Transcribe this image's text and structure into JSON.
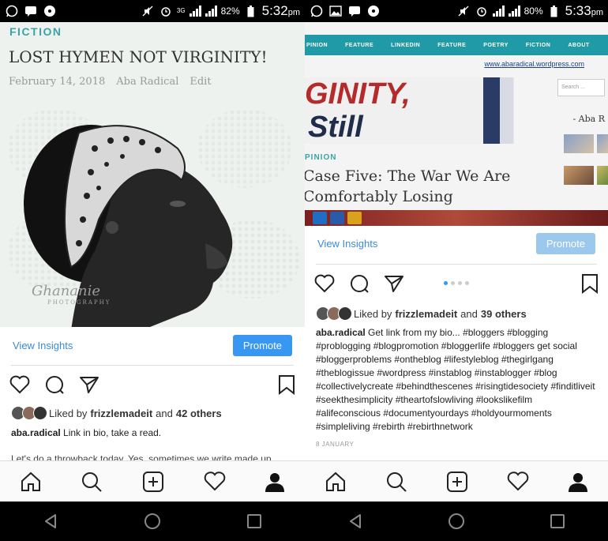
{
  "left": {
    "status": {
      "network": "3G",
      "battery": "82%",
      "time": "5:32",
      "ampm": "pm"
    },
    "post_image": {
      "category": "FICTION",
      "title": "LOST HYMEN NOT VIRGINITY!",
      "date": "February 14, 2018",
      "author": "Aba Radical",
      "edit": "Edit",
      "watermark": "Ghananie",
      "watermark_sub": "PHOTOGRAPHY"
    },
    "view_insights": "View Insights",
    "promote": "Promote",
    "liked_prefix": "Liked by",
    "liked_user": "frizzlemadeit",
    "liked_and": "and",
    "liked_count": "42 others",
    "caption_user": "aba.radical",
    "caption_text": "Link in bio, take a read.",
    "more_text": "Let's do a throwback today. Yes, sometimes we write made up"
  },
  "right": {
    "status": {
      "battery": "80%",
      "time": "5:33",
      "ampm": "pm"
    },
    "post_image": {
      "nav": [
        "PINION",
        "FEATURE",
        "LINKEDIN",
        "FEATURE",
        "POETRY",
        "FICTION",
        "ABOUT"
      ],
      "url": "www.abaradical.wordpress.com",
      "banner_line1": "GINITY,",
      "banner_line2": "Still",
      "search_placeholder": "Search ...",
      "sidebar_name": "- Aba R",
      "category": "PINION",
      "title": "Case Five: The War We Are Comfortably Losing"
    },
    "view_insights": "View Insights",
    "promote": "Promote",
    "liked_prefix": "Liked by",
    "liked_user": "frizzlemadeit",
    "liked_and": "and",
    "liked_count": "39 others",
    "caption_user": "aba.radical",
    "caption_text": "Get link from my bio... #bloggers #blogging #problogging #blogpromotion #bloggerlife #bloggers get social #bloggerproblems #ontheblog #lifestyleblog #thegirlgang #theblogissue #wordpress #instablog #instablogger #blog #collectivelycreate #behindthescenes #risingtidesociety #finditliveit #seekthesimplicity #theartofslowliving #lookslikefilm #alifeconscious #documentyourdays #holdyourmoments #simpleliving #rebirth #rebirthnetwork",
    "date": "8 JANUARY"
  },
  "colors": {
    "accent": "#3897f0",
    "link": "#3a8bd6",
    "teal": "#1f9aa6"
  }
}
